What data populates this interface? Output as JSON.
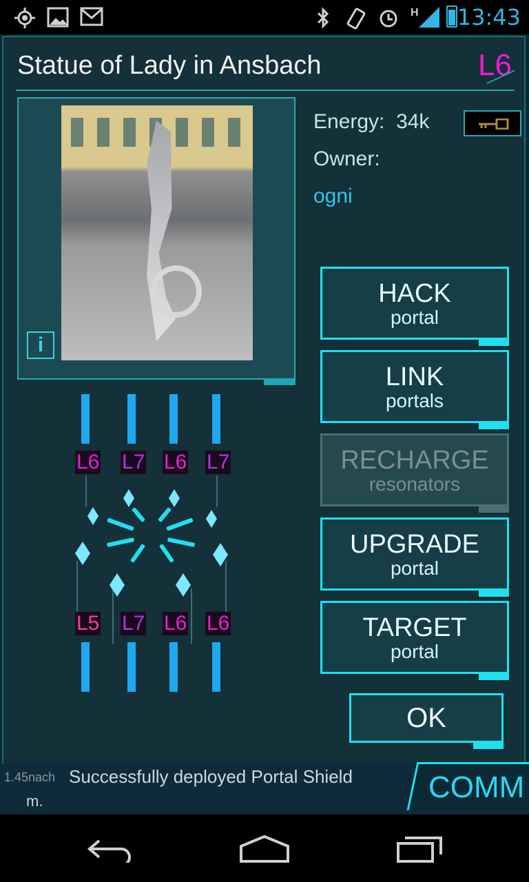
{
  "status_bar": {
    "time": "13:43",
    "left_icons": [
      "location-icon",
      "image-icon",
      "gmail-icon"
    ],
    "right_icons": [
      "bluetooth-icon",
      "vibrate-icon",
      "alarm-icon",
      "signal-icon",
      "battery-icon"
    ],
    "network": "H"
  },
  "portal": {
    "title": "Statue of Lady in Ansbach",
    "level": "L6",
    "energy_label": "Energy:",
    "energy_value": "34k",
    "owner_label": "Owner:",
    "owner_name": "ogni",
    "info_label": "i"
  },
  "actions": [
    {
      "main": "HACK",
      "sub": "portal",
      "enabled": true
    },
    {
      "main": "LINK",
      "sub": "portals",
      "enabled": true
    },
    {
      "main": "RECHARGE",
      "sub": "resonators",
      "enabled": false
    },
    {
      "main": "UPGRADE",
      "sub": "portal",
      "enabled": true
    },
    {
      "main": "TARGET",
      "sub": "portal",
      "enabled": true
    }
  ],
  "ok_label": "OK",
  "resonators": {
    "top": [
      "L6",
      "L7",
      "L6",
      "L7"
    ],
    "bottom": [
      "L5",
      "L7",
      "L6",
      "L6"
    ]
  },
  "comm": {
    "message": "Successfully deployed Portal Shield",
    "meta": "1.45nach",
    "suffix": "m.",
    "button_label": "COMM"
  },
  "colors": {
    "accent": "#1ee0f0",
    "level_L5": "#f0448c",
    "level_L6": "#e81fd4",
    "level_L7": "#b233e8",
    "owner": "#33c4f0"
  }
}
